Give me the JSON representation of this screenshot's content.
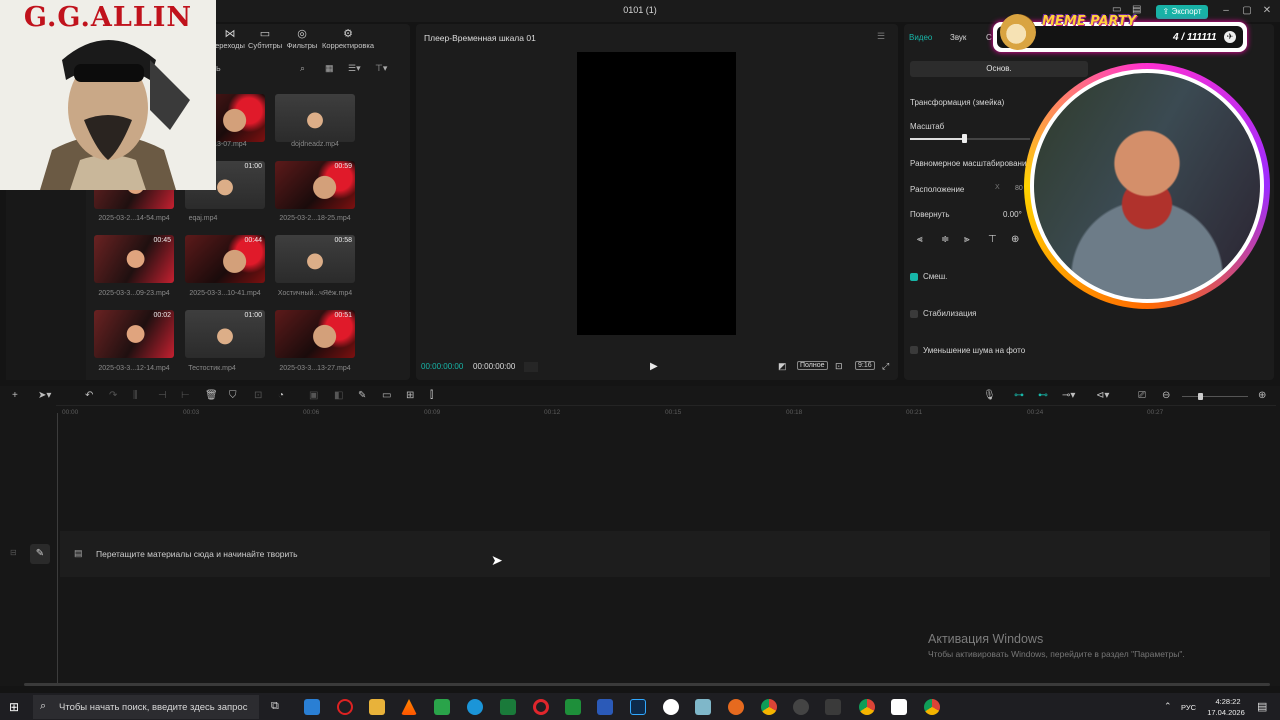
{
  "window": {
    "title": "0101 (1)",
    "export_label": "Экспорт"
  },
  "media": {
    "tabs": [
      "ереходы",
      "Субтитры",
      "Фильтры",
      "Корректировка"
    ],
    "sidebar_fragment": "ь",
    "files": [
      {
        "name": "2...13-07.mp4",
        "duration": ""
      },
      {
        "name": "dojdneadz.mp4",
        "duration": ""
      },
      {
        "name": "2025-03-2...14-54.mp4",
        "duration": ""
      },
      {
        "name": "eqaj.mp4",
        "duration": "01:00"
      },
      {
        "name": "2025-03-2...18-25.mp4",
        "duration": "00:59"
      },
      {
        "name": "2025-03-3...09-23.mp4",
        "duration": "00:45"
      },
      {
        "name": "2025-03-3...10-41.mp4",
        "duration": "00:44"
      },
      {
        "name": "Хостичный...чЯёж.mp4",
        "duration": "00:58"
      },
      {
        "name": "2025-03-3...12-14.mp4",
        "duration": "00:02"
      },
      {
        "name": "Тестостик.mp4",
        "duration": "01:00"
      },
      {
        "name": "2025-03-3...13-27.mp4",
        "duration": "00:51"
      }
    ]
  },
  "overlay": {
    "gg_title": "G.G.ALLIN"
  },
  "player": {
    "title": "Плеер-Временная шкала 01",
    "current_time": "00:00:00:00",
    "total_time": "00:00:00:00",
    "full_label": "Полное",
    "ratio_label": "9:16"
  },
  "props": {
    "tabs": [
      "Видео",
      "Звук",
      "С"
    ],
    "basic_label": "Основ.",
    "transform": "Трансформация (змейка)",
    "scale": "Масштаб",
    "uniform_scale": "Равномерное масштабирование",
    "position": "Расположение",
    "position_x_label": "X",
    "position_x": "80",
    "rotate": "Повернуть",
    "rotate_value": "0.00°",
    "blend": "Смеш.",
    "stabilize": "Стабилизация",
    "denoise": "Уменьшение шума на фото"
  },
  "stream": {
    "title": "MEME PARTY",
    "count": "4 / 111111"
  },
  "timeline": {
    "ruler": [
      "00:00",
      "00:03",
      "00:06",
      "00:09",
      "00:12",
      "00:15",
      "00:18",
      "00:21",
      "00:24",
      "00:27"
    ],
    "hint": "Перетащите материалы сюда и начинайте творить"
  },
  "activation": {
    "title": "Активация Windows",
    "subtitle": "Чтобы активировать Windows, перейдите в раздел \"Параметры\"."
  },
  "taskbar": {
    "search_placeholder": "Чтобы начать поиск, введите здесь запрос",
    "lang": "РУС",
    "time": "4:28:22",
    "date": "17.04.2026"
  },
  "colors": {
    "accent": "#18b2a6",
    "background": "#141414",
    "panel": "#1c1c1c"
  }
}
